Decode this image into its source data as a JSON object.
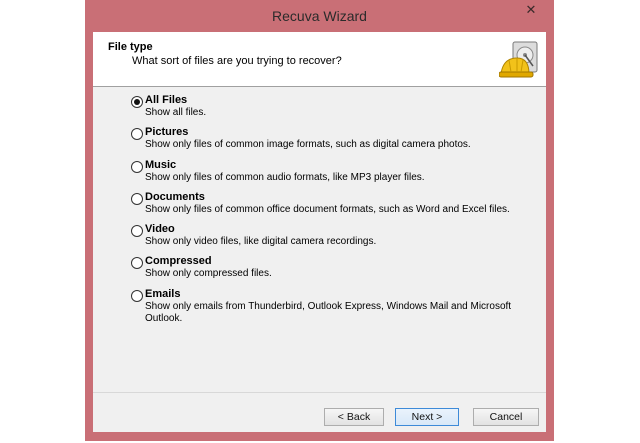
{
  "window": {
    "title": "Recuva Wizard",
    "close_glyph": "✕"
  },
  "header": {
    "title": "File type",
    "subtitle": "What sort of files are you trying to recover?",
    "icon": "hard-drive-with-helmet-icon"
  },
  "options": [
    {
      "label": "All Files",
      "description": "Show all files.",
      "selected": true
    },
    {
      "label": "Pictures",
      "description": "Show only files of common image formats, such as digital camera photos.",
      "selected": false
    },
    {
      "label": "Music",
      "description": "Show only files of common audio formats, like MP3 player files.",
      "selected": false
    },
    {
      "label": "Documents",
      "description": "Show only files of common office document formats, such as Word and Excel files.",
      "selected": false
    },
    {
      "label": "Video",
      "description": "Show only video files, like digital camera recordings.",
      "selected": false
    },
    {
      "label": "Compressed",
      "description": "Show only compressed files.",
      "selected": false
    },
    {
      "label": "Emails",
      "description": "Show only emails from Thunderbird, Outlook Express, Windows Mail and Microsoft Outlook.",
      "selected": false
    }
  ],
  "buttons": {
    "back": "< Back",
    "next": "Next >",
    "cancel": "Cancel"
  },
  "colors": {
    "frame": "#c96f76",
    "client": "#f0f0f0",
    "header": "#ffffff",
    "default_button_border": "#3d8ad8"
  }
}
